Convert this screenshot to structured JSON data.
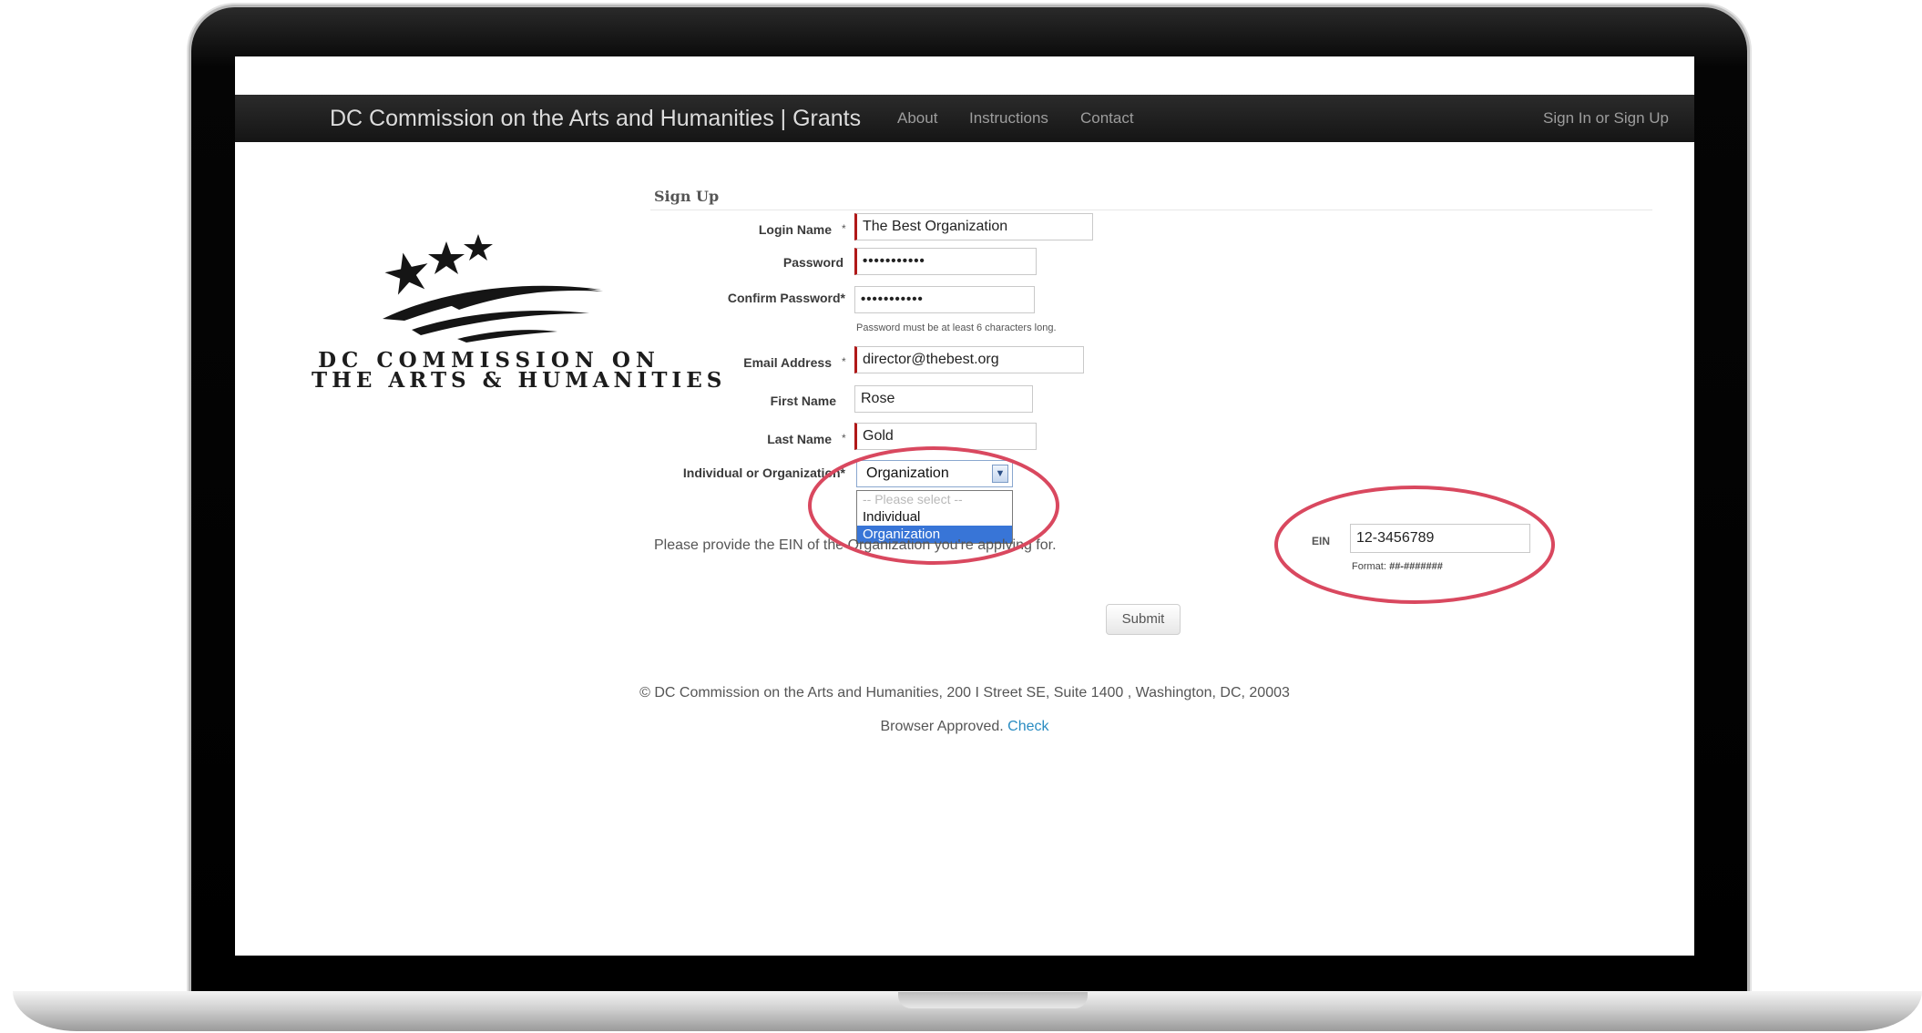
{
  "navbar": {
    "brand": "DC Commission on the Arts and Humanities | Grants",
    "links": [
      "About",
      "Instructions",
      "Contact"
    ],
    "account": "Sign In or Sign Up"
  },
  "logo": {
    "line1": "DC COMMISSION ON",
    "line2": "THE ARTS & HUMANITIES"
  },
  "form": {
    "title": "Sign Up",
    "required_marker": "*",
    "login_name": {
      "label": "Login Name",
      "value": "The Best Organization"
    },
    "password": {
      "label": "Password",
      "value": "•••••••••••"
    },
    "confirm_password": {
      "label": "Confirm Password*",
      "value": "•••••••••••"
    },
    "password_hint": "Password must be at least 6 characters long.",
    "email": {
      "label": "Email Address",
      "value": "director@thebest.org"
    },
    "first_name": {
      "label": "First Name",
      "value": "Rose"
    },
    "last_name": {
      "label": "Last Name",
      "value": "Gold"
    },
    "type": {
      "label": "Individual or Organization*",
      "selected": "Organization",
      "options": [
        "-- Please select --",
        "Individual",
        "Organization"
      ]
    },
    "ein_note": "Please provide the EIN of the Organization you're applying for.",
    "ein": {
      "label": "EIN",
      "value": "12-3456789",
      "format_label": "Format:",
      "format_value": "##-#######"
    },
    "submit": "Submit"
  },
  "footer": {
    "address": "© DC Commission on the Arts and Humanities, 200 I Street SE, Suite 1400 , Washington, DC, 20003",
    "browser_text": "Browser Approved.",
    "browser_link": "Check"
  },
  "colors": {
    "navbar": "#1d1d1d",
    "required_border": "#b01818",
    "selected_option": "#3875d7",
    "annotation": "#d9485f",
    "link": "#2a8cc2"
  }
}
